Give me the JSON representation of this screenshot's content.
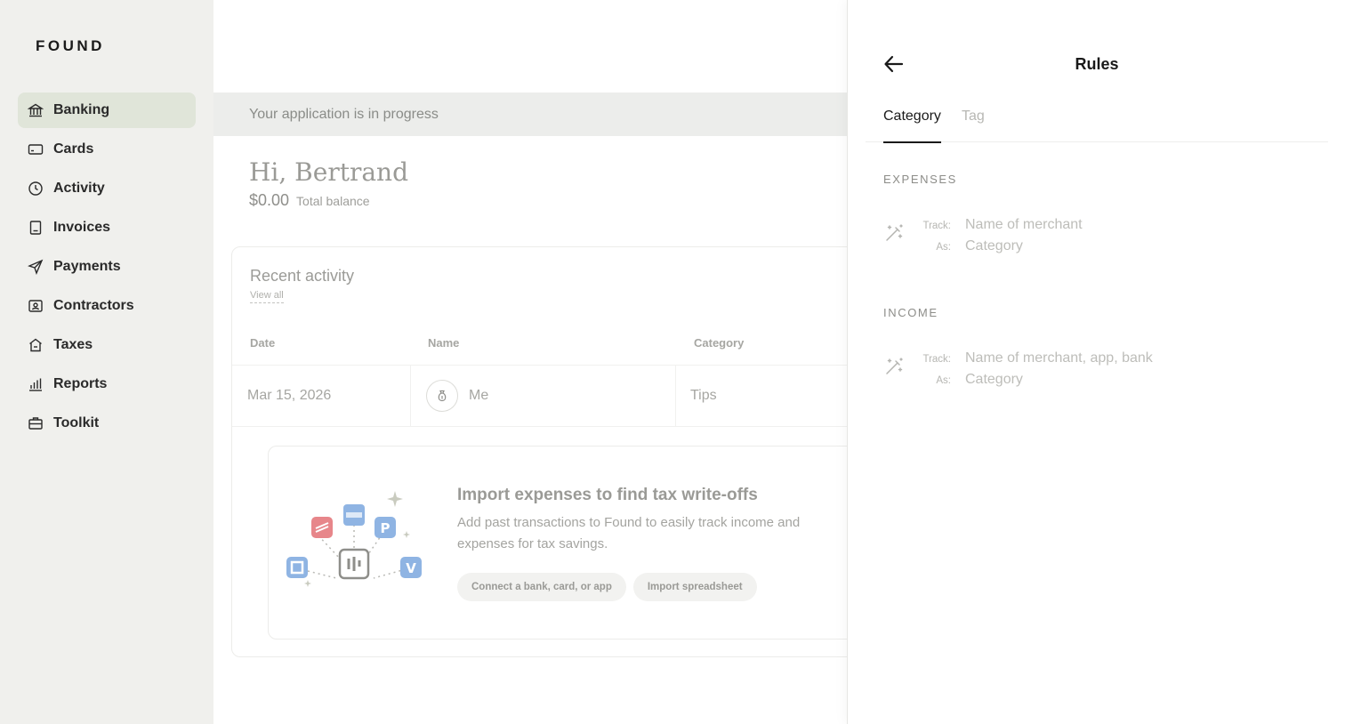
{
  "app": {
    "logo": "FOUND"
  },
  "sidebar": {
    "items": [
      {
        "label": "Banking",
        "icon": "bank-icon",
        "active": true
      },
      {
        "label": "Cards",
        "icon": "card-icon",
        "active": false
      },
      {
        "label": "Activity",
        "icon": "clock-icon",
        "active": false
      },
      {
        "label": "Invoices",
        "icon": "invoice-icon",
        "active": false
      },
      {
        "label": "Payments",
        "icon": "send-icon",
        "active": false
      },
      {
        "label": "Contractors",
        "icon": "contractor-icon",
        "active": false
      },
      {
        "label": "Taxes",
        "icon": "taxes-icon",
        "active": false
      },
      {
        "label": "Reports",
        "icon": "bar-chart-icon",
        "active": false
      },
      {
        "label": "Toolkit",
        "icon": "briefcase-icon",
        "active": false
      }
    ]
  },
  "main": {
    "banner": "Your application is in progress",
    "greeting": "Hi, Bertrand",
    "balance": {
      "amount": "$0.00",
      "label": "Total balance"
    },
    "recent_activity": {
      "title": "Recent activity",
      "view_all": "View all",
      "columns": [
        "Date",
        "Name",
        "Category"
      ],
      "rows": [
        {
          "date": "Mar 15, 2026",
          "name": "Me",
          "category": "Tips"
        }
      ]
    },
    "import": {
      "title": "Import expenses to find tax write-offs",
      "description": "Add past transactions to Found to easily track income and expenses for tax savings.",
      "connect_button": "Connect a bank, card, or app",
      "spreadsheet_button": "Import spreadsheet"
    }
  },
  "panel": {
    "title": "Rules",
    "tabs": [
      {
        "label": "Category",
        "active": true
      },
      {
        "label": "Tag",
        "active": false
      }
    ],
    "expenses": {
      "label": "EXPENSES",
      "track_key": "Track:",
      "as_key": "As:",
      "track_placeholder": "Name of merchant",
      "as_placeholder": "Category"
    },
    "income": {
      "label": "INCOME",
      "track_key": "Track:",
      "as_key": "As:",
      "track_placeholder": "Name of merchant, app, bank",
      "as_placeholder": "Category"
    }
  },
  "colors": {
    "sidebar_bg": "#f0f0ed",
    "active_nav_bg": "#e0e5d9",
    "banner_bg": "#ecedeb",
    "text_dark": "#1a1a1a"
  }
}
